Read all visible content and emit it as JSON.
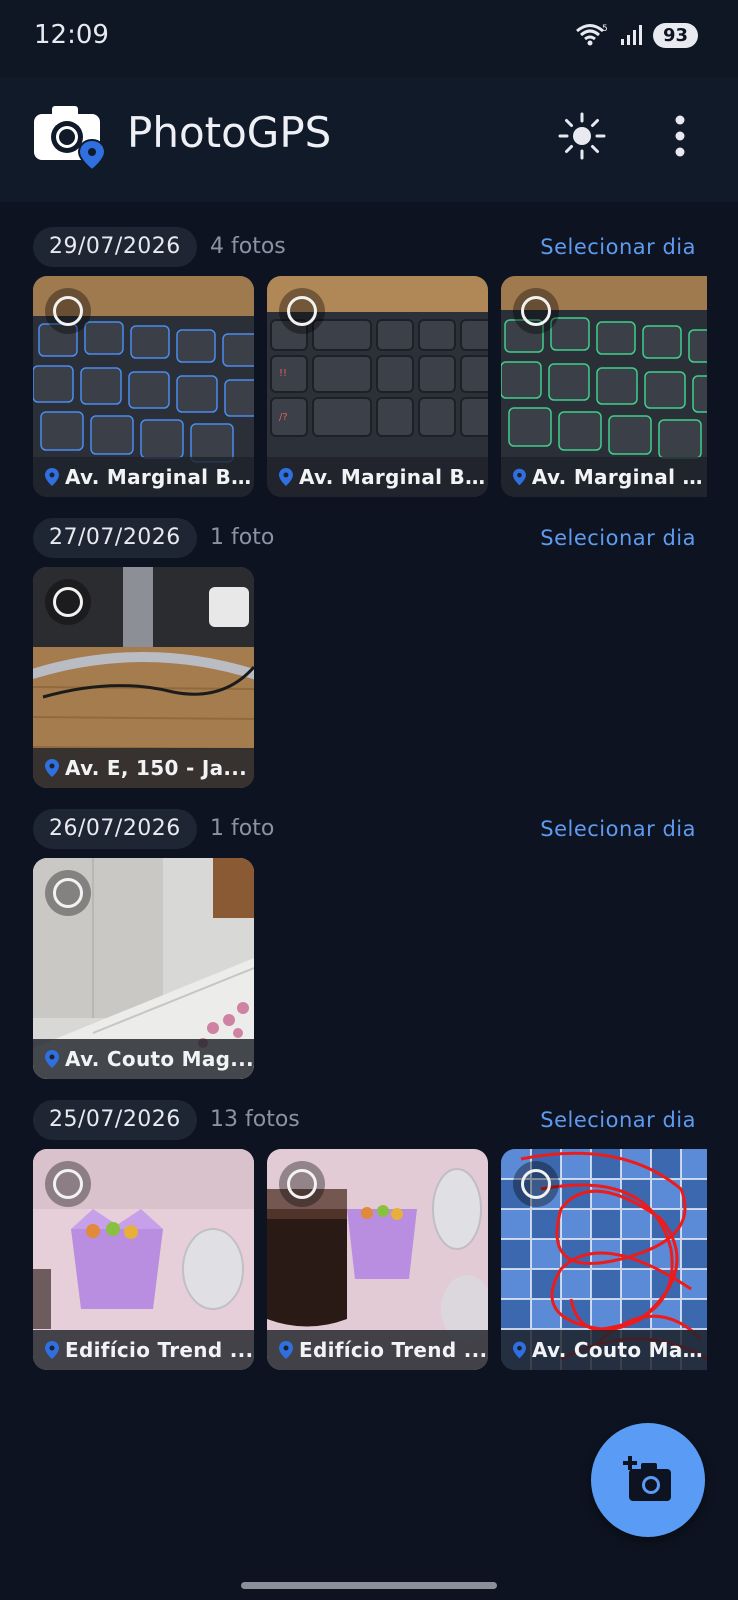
{
  "status_bar": {
    "time": "12:09",
    "battery": "93",
    "wifi_badge": "5"
  },
  "app_bar": {
    "title": "PhotoGPS",
    "icons": [
      "camera-pin-logo",
      "brightness-icon",
      "more-vert-icon"
    ]
  },
  "select_label": "Selecionar dia",
  "groups": [
    {
      "date": "29/07/2026",
      "count": "4 fotos",
      "photos": [
        {
          "location": "Av. Marginal B...",
          "scene": "keyboard-blue"
        },
        {
          "location": "Av. Marginal B...",
          "scene": "keyboard-red"
        },
        {
          "location": "Av. Marginal B...",
          "scene": "keyboard-green"
        }
      ]
    },
    {
      "date": "27/07/2026",
      "count": "1 foto",
      "photos": [
        {
          "location": "Av. E, 150 - Ja...",
          "scene": "desk"
        }
      ]
    },
    {
      "date": "26/07/2026",
      "count": "1 foto",
      "photos": [
        {
          "location": "Av. Couto Mag...",
          "scene": "tiles"
        }
      ]
    },
    {
      "date": "25/07/2026",
      "count": "13 fotos",
      "photos": [
        {
          "location": "Edifício Trend ...",
          "scene": "party-box"
        },
        {
          "location": "Edifício Trend ...",
          "scene": "party-glass"
        },
        {
          "location": "Av. Couto Mag...",
          "scene": "drawing"
        }
      ]
    }
  ],
  "colors": {
    "background": "#0d1320",
    "accent": "#5e9bf0",
    "fab": "#5a9cf5",
    "pin": "#2f6fe0"
  },
  "fab": {
    "icon": "add-camera-icon"
  }
}
